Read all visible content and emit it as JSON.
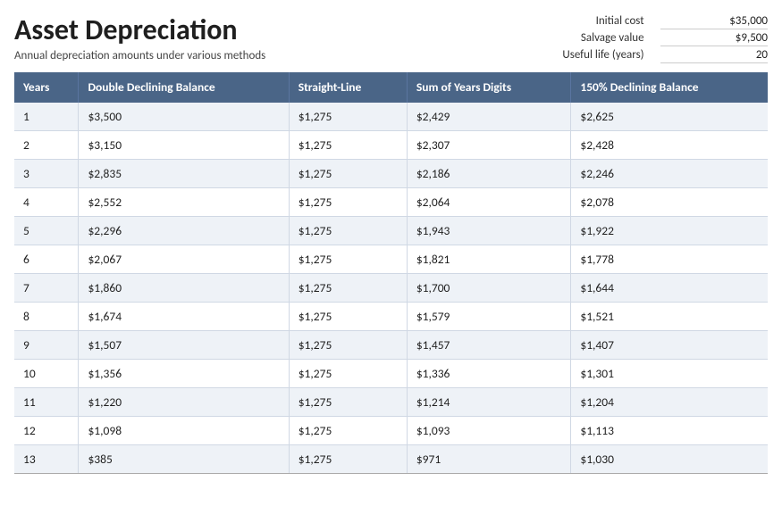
{
  "header": {
    "title": "Asset Depreciation",
    "subtitle": "Annual depreciation amounts under various methods"
  },
  "info": {
    "items": [
      {
        "label": "Initial cost",
        "value": "$35,000"
      },
      {
        "label": "Salvage value",
        "value": "$9,500"
      },
      {
        "label": "Useful life (years)",
        "value": "20"
      }
    ]
  },
  "table": {
    "columns": [
      {
        "id": "years",
        "label": "Years"
      },
      {
        "id": "double_declining",
        "label": "Double Declining Balance"
      },
      {
        "id": "straight_line",
        "label": "Straight-Line"
      },
      {
        "id": "sum_of_years",
        "label": "Sum of Years Digits"
      },
      {
        "id": "declining_150",
        "label": "150% Declining Balance"
      }
    ],
    "rows": [
      {
        "year": "1",
        "double_declining": "$3,500",
        "straight_line": "$1,275",
        "sum_of_years": "$2,429",
        "declining_150": "$2,625"
      },
      {
        "year": "2",
        "double_declining": "$3,150",
        "straight_line": "$1,275",
        "sum_of_years": "$2,307",
        "declining_150": "$2,428"
      },
      {
        "year": "3",
        "double_declining": "$2,835",
        "straight_line": "$1,275",
        "sum_of_years": "$2,186",
        "declining_150": "$2,246"
      },
      {
        "year": "4",
        "double_declining": "$2,552",
        "straight_line": "$1,275",
        "sum_of_years": "$2,064",
        "declining_150": "$2,078"
      },
      {
        "year": "5",
        "double_declining": "$2,296",
        "straight_line": "$1,275",
        "sum_of_years": "$1,943",
        "declining_150": "$1,922"
      },
      {
        "year": "6",
        "double_declining": "$2,067",
        "straight_line": "$1,275",
        "sum_of_years": "$1,821",
        "declining_150": "$1,778"
      },
      {
        "year": "7",
        "double_declining": "$1,860",
        "straight_line": "$1,275",
        "sum_of_years": "$1,700",
        "declining_150": "$1,644"
      },
      {
        "year": "8",
        "double_declining": "$1,674",
        "straight_line": "$1,275",
        "sum_of_years": "$1,579",
        "declining_150": "$1,521"
      },
      {
        "year": "9",
        "double_declining": "$1,507",
        "straight_line": "$1,275",
        "sum_of_years": "$1,457",
        "declining_150": "$1,407"
      },
      {
        "year": "10",
        "double_declining": "$1,356",
        "straight_line": "$1,275",
        "sum_of_years": "$1,336",
        "declining_150": "$1,301"
      },
      {
        "year": "11",
        "double_declining": "$1,220",
        "straight_line": "$1,275",
        "sum_of_years": "$1,214",
        "declining_150": "$1,204"
      },
      {
        "year": "12",
        "double_declining": "$1,098",
        "straight_line": "$1,275",
        "sum_of_years": "$1,093",
        "declining_150": "$1,113"
      },
      {
        "year": "13",
        "double_declining": "$385",
        "straight_line": "$1,275",
        "sum_of_years": "$971",
        "declining_150": "$1,030"
      }
    ]
  }
}
